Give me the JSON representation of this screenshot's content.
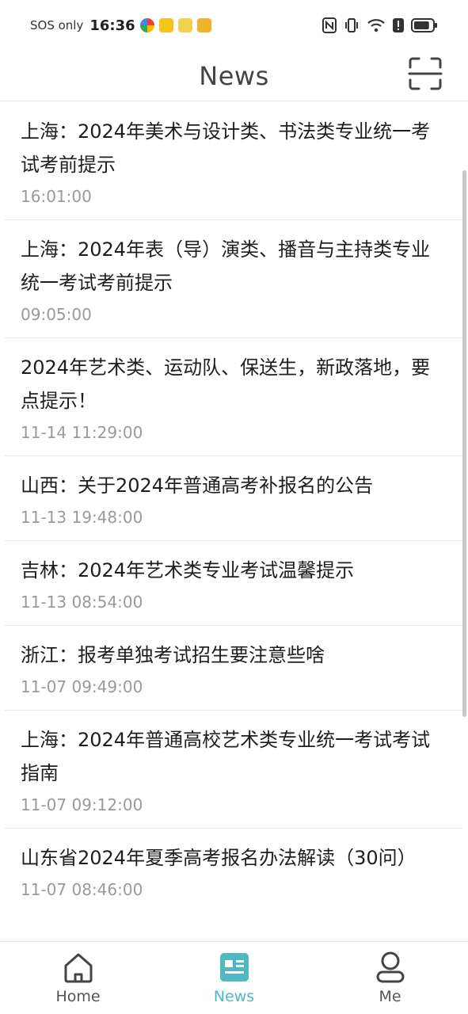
{
  "status_bar": {
    "sos_text": "SOS only",
    "time": "16:36",
    "battery_level": 0.85
  },
  "header": {
    "title": "News"
  },
  "news": [
    {
      "title": "上海：2024年美术与设计类、书法类专业统一考试考前提示",
      "time": "16:01:00"
    },
    {
      "title": "上海：2024年表（导）演类、播音与主持类专业统一考试考前提示",
      "time": "09:05:00"
    },
    {
      "title": "2024年艺术类、运动队、保送生，新政落地，要点提示！",
      "time": "11-14 11:29:00"
    },
    {
      "title": "山西：关于2024年普通高考补报名的公告",
      "time": "11-13 19:48:00"
    },
    {
      "title": "吉林：2024年艺术类专业考试温馨提示",
      "time": "11-13 08:54:00"
    },
    {
      "title": "浙江：报考单独考试招生要注意些啥",
      "time": "11-07 09:49:00"
    },
    {
      "title": "上海：2024年普通高校艺术类专业统一考试考试指南",
      "time": "11-07 09:12:00"
    },
    {
      "title": "山东省2024年夏季高考报名办法解读（30问）",
      "time": "11-07 08:46:00"
    }
  ],
  "bottom_nav": {
    "items": [
      {
        "label": "Home",
        "icon": "home-icon",
        "active": false
      },
      {
        "label": "News",
        "icon": "news-icon",
        "active": true
      },
      {
        "label": "Me",
        "icon": "person-icon",
        "active": false
      }
    ]
  },
  "colors": {
    "accent": "#4fb9c2",
    "text_primary": "#1e1e1e",
    "text_secondary": "#9a9a9a"
  }
}
